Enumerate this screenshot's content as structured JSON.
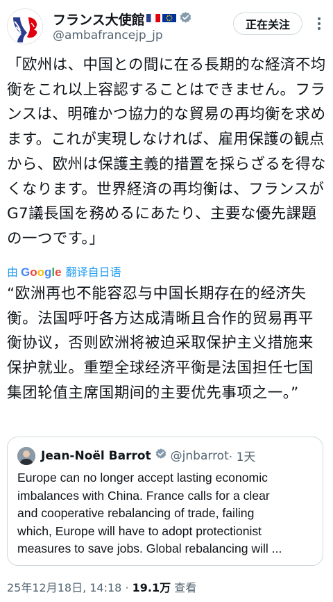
{
  "account": {
    "display_name": "フランス大使館",
    "handle": "@ambafrancejp_jp",
    "follow_label": "正在关注"
  },
  "tweet": {
    "text": "「欧州は、中国との間に在る長期的な経済不均衡をこれ以上容認することはできません。フランスは、明確かつ協力的な貿易の再均衡を求めます。これが実現しなければ、雇用保護の観点から、欧州は保護主義的措置を採らざるを得なくなります。世界経済の再均衡は、フランスがG7議長国を務めるにあたり、主要な優先課題の一つです。」",
    "translate_by": "由",
    "translate_brand": "Google",
    "translate_label": "翻译自日语",
    "translation": "“欧洲再也不能容忍与中国长期存在的经济失衡。法国呼吁各方达成清晰且合作的贸易再平衡协议，否则欧洲将被迫采取保护主义措施来保护就业。重塑全球经济平衡是法国担任七国集团轮值主席国期间的主要优先事项之一。”",
    "date": "25年12月18日, 14:18",
    "separator": " · ",
    "views_count": "19.1万",
    "views_label": "查看"
  },
  "quote": {
    "display_name": "Jean-Noël Barrot",
    "handle": "@jnbarrot",
    "time": "· 1天",
    "lines": [
      "Europe can no longer accept lasting economic",
      "imbalances with China. France calls for a clear",
      "and cooperative rebalancing of trade, failing",
      "which, Europe will have to adopt protectionist",
      "measures to save jobs. Global rebalancing will ..."
    ]
  },
  "colors": {
    "accent": "#1d9bf0",
    "secondary_text": "#536471",
    "border": "#cfd9de",
    "french_blue": "#2b3d8f",
    "french_red": "#e1000f",
    "eu_blue": "#003399",
    "eu_gold": "#ffcc00"
  },
  "icons": {
    "avatar": "marianne-logo",
    "verified": "verified-badge-icon",
    "more": "more-vertical-icon",
    "flags": [
      "france-flag",
      "eu-flag"
    ]
  }
}
